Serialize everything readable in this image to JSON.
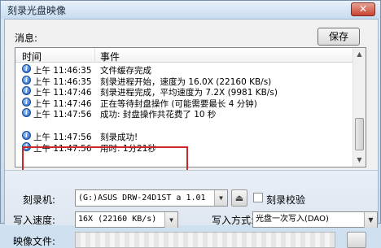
{
  "window": {
    "title": "刻录光盘映像",
    "close_glyph": "✕"
  },
  "messages": {
    "label": "消息:",
    "save_label": "保存",
    "columns": {
      "time": "时间",
      "event": "事件"
    },
    "rows": [
      {
        "time": "上午 11:46:35",
        "event": "文件缓存完成"
      },
      {
        "time": "上午 11:46:35",
        "event": "刻录进程开始，速度为 16.0X (22160 KB/s)"
      },
      {
        "time": "上午 11:47:46",
        "event": "刻录进程完成，平均速度为 7.2X (9981 KB/s)"
      },
      {
        "time": "上午 11:47:46",
        "event": "正在等待封盘操作 (可能需要最长 4 分钟)"
      },
      {
        "time": "上午 11:47:56",
        "event": "成功: 封盘操作共花费了 10 秒"
      },
      {
        "time": "上午 11:47:56",
        "event": "刻录成功!"
      },
      {
        "time": "上午 11:47:56",
        "event": "用时: 1分21秒"
      }
    ],
    "icon": "info-icon"
  },
  "settings": {
    "burner_label": "刻录机:",
    "burner_value": "(G:)ASUS    DRW-24D1ST   a  1.01",
    "verify_label": "刻录校验",
    "verify_checked": false,
    "speed_label": "写入速度:",
    "speed_value": "16X (22160 KB/s)",
    "mode_label": "写入方式:",
    "mode_value": "光盘一次写入(DAO)",
    "file_label": "映像文件:"
  },
  "colors": {
    "highlight": "#c8282a",
    "info_icon": "#1f5fbf"
  }
}
